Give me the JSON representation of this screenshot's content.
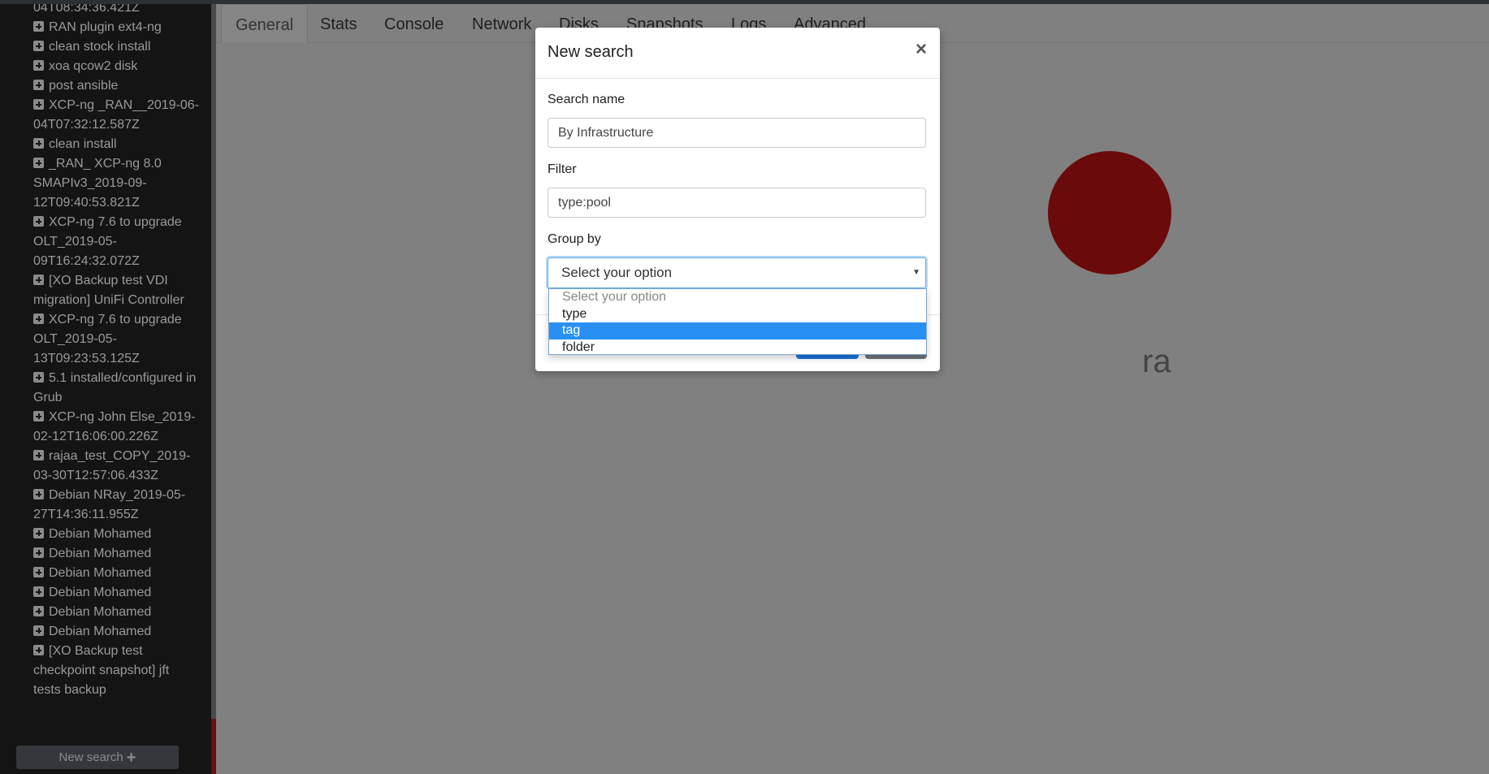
{
  "sidebar": {
    "items": [
      {
        "text": "04T08:34:36.421Z",
        "icon": false
      },
      {
        "text": "RAN plugin ext4-ng",
        "icon": true
      },
      {
        "text": "clean stock install",
        "icon": true
      },
      {
        "text": "xoa qcow2 disk",
        "icon": true
      },
      {
        "text": "post ansible",
        "icon": true
      },
      {
        "text": "XCP-ng _RAN__2019-06-04T07:32:12.587Z",
        "icon": true
      },
      {
        "text": "clean install",
        "icon": true
      },
      {
        "text": "_RAN_ XCP-ng 8.0 SMAPIv3_2019-09-12T09:40:53.821Z",
        "icon": true
      },
      {
        "text": "XCP-ng 7.6 to upgrade OLT_2019-05-09T16:24:32.072Z",
        "icon": true
      },
      {
        "text": "[XO Backup test VDI migration] UniFi Controller",
        "icon": true
      },
      {
        "text": "XCP-ng 7.6 to upgrade OLT_2019-05-13T09:23:53.125Z",
        "icon": true
      },
      {
        "text": "5.1 installed/configured in Grub",
        "icon": true
      },
      {
        "text": "XCP-ng John Else_2019-02-12T16:06:00.226Z",
        "icon": true
      },
      {
        "text": "rajaa_test_COPY_2019-03-30T12:57:06.433Z",
        "icon": true
      },
      {
        "text": "Debian NRay_2019-05-27T14:36:11.955Z",
        "icon": true
      },
      {
        "text": "Debian Mohamed",
        "icon": true
      },
      {
        "text": "Debian Mohamed",
        "icon": true
      },
      {
        "text": "Debian Mohamed",
        "icon": true
      },
      {
        "text": "Debian Mohamed",
        "icon": true
      },
      {
        "text": "Debian Mohamed",
        "icon": true
      },
      {
        "text": "Debian Mohamed",
        "icon": true
      },
      {
        "text": "[XO Backup test checkpoint snapshot] jft tests backup",
        "icon": true
      }
    ],
    "new_search_label": "New search",
    "new_search_icon": "plus-icon"
  },
  "tabs": [
    "General",
    "Stats",
    "Console",
    "Network",
    "Disks",
    "Snapshots",
    "Logs",
    "Advanced"
  ],
  "active_tab": "General",
  "background_text": "ra",
  "modal": {
    "title": "New search",
    "close_icon": "×",
    "search_name_label": "Search name",
    "search_name_value": "By Infrastructure",
    "filter_label": "Filter",
    "filter_value": "type:pool",
    "group_by_label": "Group by",
    "group_by_selected": "Select your option",
    "group_by_options": [
      "Select your option",
      "type",
      "tag",
      "folder"
    ],
    "highlighted_option": "tag"
  },
  "colors": {
    "highlight": "#2990f3",
    "primary_button": "#1a73d9",
    "accent_red": "#6b0a0a"
  }
}
